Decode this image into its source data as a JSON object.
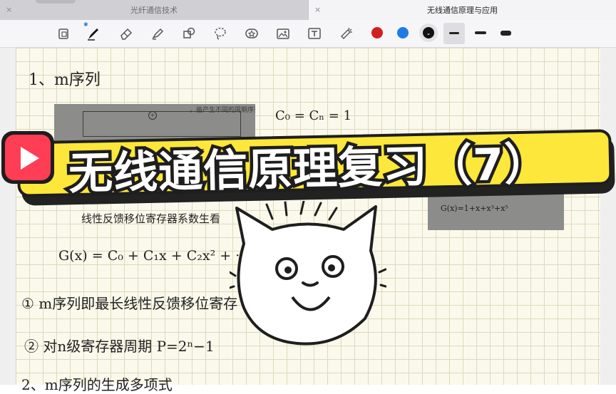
{
  "tabs": [
    {
      "title": "光纤通信技术",
      "active": false,
      "close": "×"
    },
    {
      "title": "无线通信原理与应用",
      "active": true,
      "close": "×"
    }
  ],
  "toolbar": {
    "tools": [
      "layout-icon",
      "pen-icon",
      "eraser-icon",
      "highlighter-icon",
      "shapes-icon",
      "lasso-icon",
      "sticker-icon",
      "image-icon",
      "text-icon",
      "laser-pointer-icon"
    ],
    "bluetooth": "✱",
    "colors": [
      "#d21f1f",
      "#1f7be6",
      "#111111"
    ],
    "stroke_sizes": [
      "thin",
      "medium",
      "thick"
    ]
  },
  "notes": {
    "heading": "1、m序列",
    "equation": "C₀ = Cₙ = 1",
    "photo_caption_left": "，画产生不同的周期序列。",
    "photo_caption_right": "G(x)=1+x+x³+x⁵",
    "feedback_label": "线性反馈移位寄存器系数生看",
    "poly": "G(x) = C₀ + C₁x + C₂x² + ···",
    "item1": "① m序列即最长线性反馈移位寄存",
    "item2": "② 对n级寄存器周期 P=2ⁿ−1",
    "item3": "2、m序列的生成多项式"
  },
  "banner": {
    "title": "无线通信原理复习（7）",
    "colors": {
      "fill": "#fde73a",
      "outline": "#1e1e1e",
      "text": "#ffffff",
      "badge": "#ff3d55"
    }
  }
}
